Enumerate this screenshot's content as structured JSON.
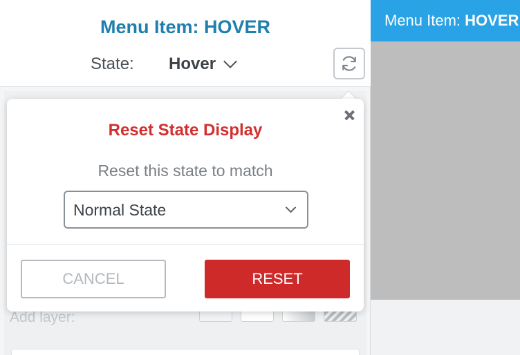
{
  "panel": {
    "title": "Menu Item: HOVER",
    "state_label": "State:",
    "state_value": "Hover",
    "add_layer_label": "Add layer:"
  },
  "preview": {
    "label_prefix": "Menu Item: ",
    "label_state": "HOVER"
  },
  "popover": {
    "title": "Reset State Display",
    "description": "Reset this state to match",
    "select_value": "Normal State",
    "cancel_label": "CANCEL",
    "reset_label": "RESET"
  },
  "icons": {
    "refresh": "refresh-icon",
    "close": "close-icon",
    "chevron": "chevron-down-icon"
  },
  "colors": {
    "title_blue": "#1f7fae",
    "danger_red": "#cf2a2a",
    "preview_blue": "#29a3e5",
    "canvas_gray": "#bdbdbd"
  }
}
